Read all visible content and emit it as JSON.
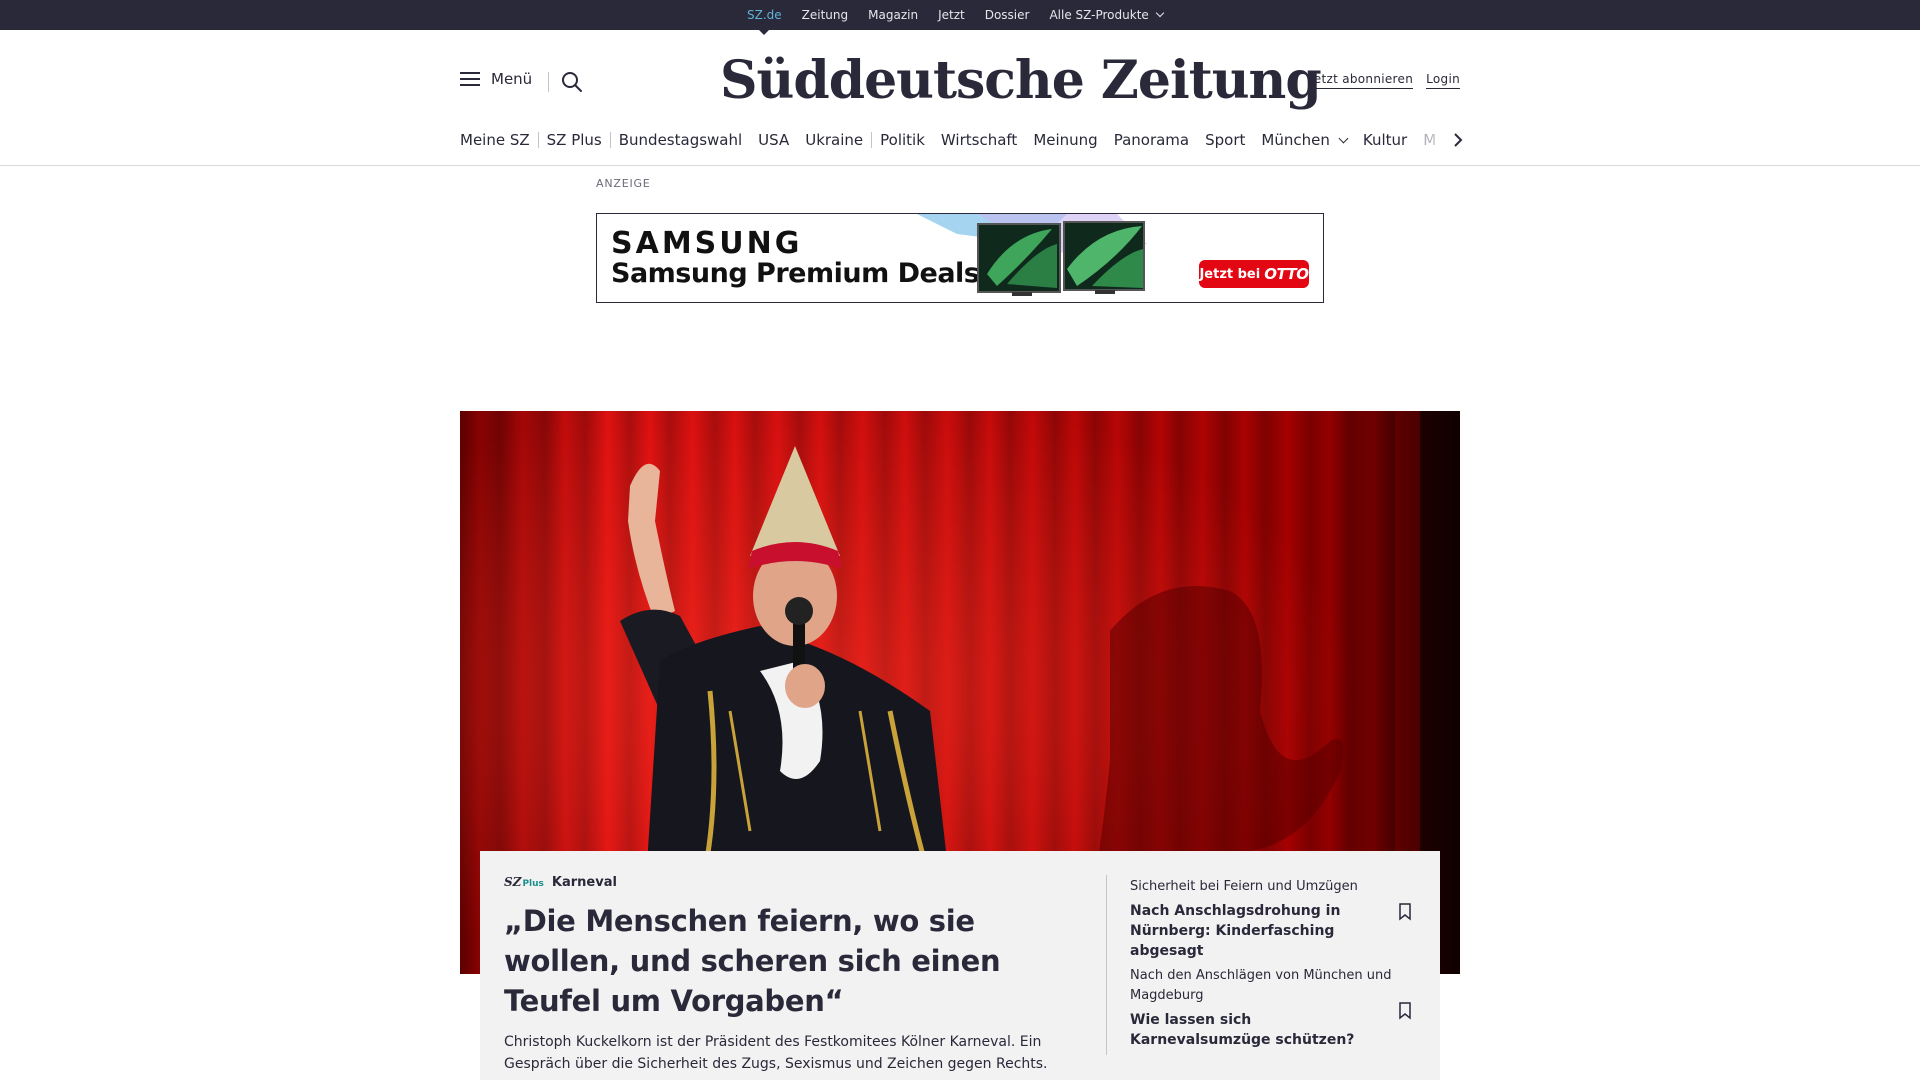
{
  "topbar": {
    "items": [
      {
        "label": "SZ.de",
        "active": true
      },
      {
        "label": "Zeitung"
      },
      {
        "label": "Magazin"
      },
      {
        "label": "Jetzt"
      },
      {
        "label": "Dossier"
      },
      {
        "label": "Alle SZ-Produkte"
      }
    ]
  },
  "header": {
    "menu_label": "Menü",
    "logo": "Süddeutsche Zeitung",
    "subscribe_label": "Jetzt abonnieren",
    "login_label": "Login",
    "icons": [
      "hamburger-icon",
      "search-icon",
      "chevron-right-icon"
    ]
  },
  "nav": {
    "items": [
      "Meine SZ",
      "SZ Plus",
      "Bundestagswahl",
      "USA",
      "Ukraine",
      "Politik",
      "Wirtschaft",
      "Meinung",
      "Panorama",
      "Sport",
      "München",
      "Kultur",
      "M"
    ]
  },
  "ad": {
    "label": "ANZEIGE",
    "brand": "SAMSUNG",
    "headline": "Samsung Premium Deals",
    "cta_text": "Jetzt bei",
    "cta_brand": "OTTO"
  },
  "hero": {
    "image_description": "Karneval performer in red curtain stage"
  },
  "teaser": {
    "badge_sz": "SZ",
    "badge_plus": "Plus",
    "kicker": "Karneval",
    "headline": "„Die Menschen feiern, wo sie wollen, und scheren sich einen Teufel um Vorgaben“",
    "text": "Christoph Kuckelkorn ist der Präsident des Festkomitees Kölner Karneval. Ein Gespräch über die Sicherheit des Zugs, Sexismus und Zeichen gegen Rechts."
  },
  "side_articles": [
    {
      "kicker": "Sicherheit bei Feiern und Umzügen",
      "title": "Nach Anschlagsdrohung in Nürnberg: Kinderfasching abgesagt"
    },
    {
      "kicker": "Nach den Anschlägen von München und Magdeburg",
      "title": "Wie lassen sich Karnevalsumzüge schützen?"
    }
  ],
  "colors": {
    "brand_dark": "#29293a",
    "topbar_active": "#5fb3d6",
    "szplus_accent": "#1a8f8a",
    "otto_red": "#e30613",
    "hero_red": "#c40000"
  }
}
